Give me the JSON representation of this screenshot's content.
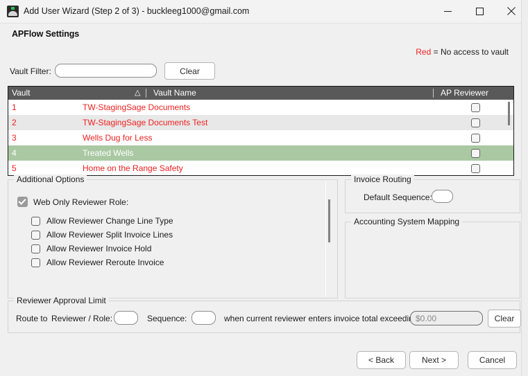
{
  "window": {
    "title": "Add User Wizard (Step 2 of 3) - buckleeg1000@gmail.com",
    "app_icon": "app-logo-icon",
    "controls": {
      "minimize": "minimize-icon",
      "maximize": "maximize-icon",
      "close": "close-icon"
    }
  },
  "page": {
    "heading": "APFlow Settings",
    "legend": {
      "red_word": "Red",
      "text": "= No access to vault",
      "red_color": "#ef2020"
    }
  },
  "vault_filter": {
    "label": "Vault Filter:",
    "value": "",
    "placeholder": "",
    "clear_label": "Clear"
  },
  "grid": {
    "columns": [
      "Vault",
      "Vault Name",
      "AP Reviewer"
    ],
    "sort_indicator": "△",
    "rows": [
      {
        "vault": "1",
        "name": "TW-StagingSage Documents",
        "ap_reviewer": false,
        "no_access": true,
        "selected": false
      },
      {
        "vault": "2",
        "name": "TW-StagingSage Documents Test",
        "ap_reviewer": false,
        "no_access": true,
        "selected": false
      },
      {
        "vault": "3",
        "name": "Wells Dug for Less",
        "ap_reviewer": false,
        "no_access": true,
        "selected": false
      },
      {
        "vault": "4",
        "name": "Treated Wells",
        "ap_reviewer": false,
        "no_access": false,
        "selected": true
      },
      {
        "vault": "5",
        "name": "Home on the Range Safety",
        "ap_reviewer": false,
        "no_access": true,
        "selected": false
      }
    ],
    "selected_row_color": "#aac9a3",
    "header_color": "#595959"
  },
  "additional_options": {
    "title": "Additional Options",
    "main": {
      "label": "Web Only Reviewer Role:",
      "checked": true
    },
    "sub_options": [
      {
        "label": "Allow Reviewer Change Line Type",
        "checked": false
      },
      {
        "label": "Allow Reviewer Split Invoice Lines",
        "checked": false
      },
      {
        "label": "Allow Reviewer Invoice Hold",
        "checked": false
      },
      {
        "label": "Allow Reviewer Reroute Invoice",
        "checked": false
      }
    ]
  },
  "invoice_routing": {
    "title": "Invoice Routing",
    "default_sequence_label": "Default Sequence:",
    "default_sequence_value": ""
  },
  "accounting_mapping": {
    "title": "Accounting System Mapping"
  },
  "reviewer_approval_limit": {
    "title": "Reviewer Approval Limit",
    "route_to_label": "Route to",
    "reviewer_role_label": "Reviewer / Role:",
    "reviewer_role_value": "",
    "sequence_label": "Sequence:",
    "sequence_value": "",
    "condition_text": "when current reviewer enters invoice total exceeding:",
    "amount_value": "$0.00",
    "clear_label": "Clear"
  },
  "footer": {
    "back": "< Back",
    "next": "Next >",
    "cancel": "Cancel"
  }
}
